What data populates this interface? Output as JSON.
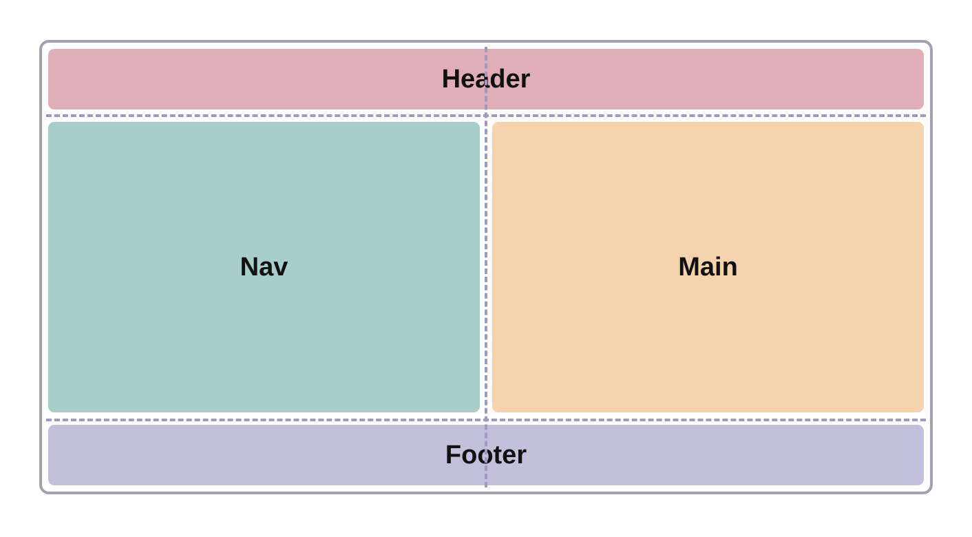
{
  "layout": {
    "header": {
      "label": "Header",
      "color": "#e0aeb9"
    },
    "nav": {
      "label": "Nav",
      "color": "#a7ceca"
    },
    "main": {
      "label": "Main",
      "color": "#f5d3ad"
    },
    "footer": {
      "label": "Footer",
      "color": "#c3c0dc"
    }
  },
  "grid": {
    "border_color": "#a0a0b0",
    "dashed_line_color": "#a09abf"
  }
}
